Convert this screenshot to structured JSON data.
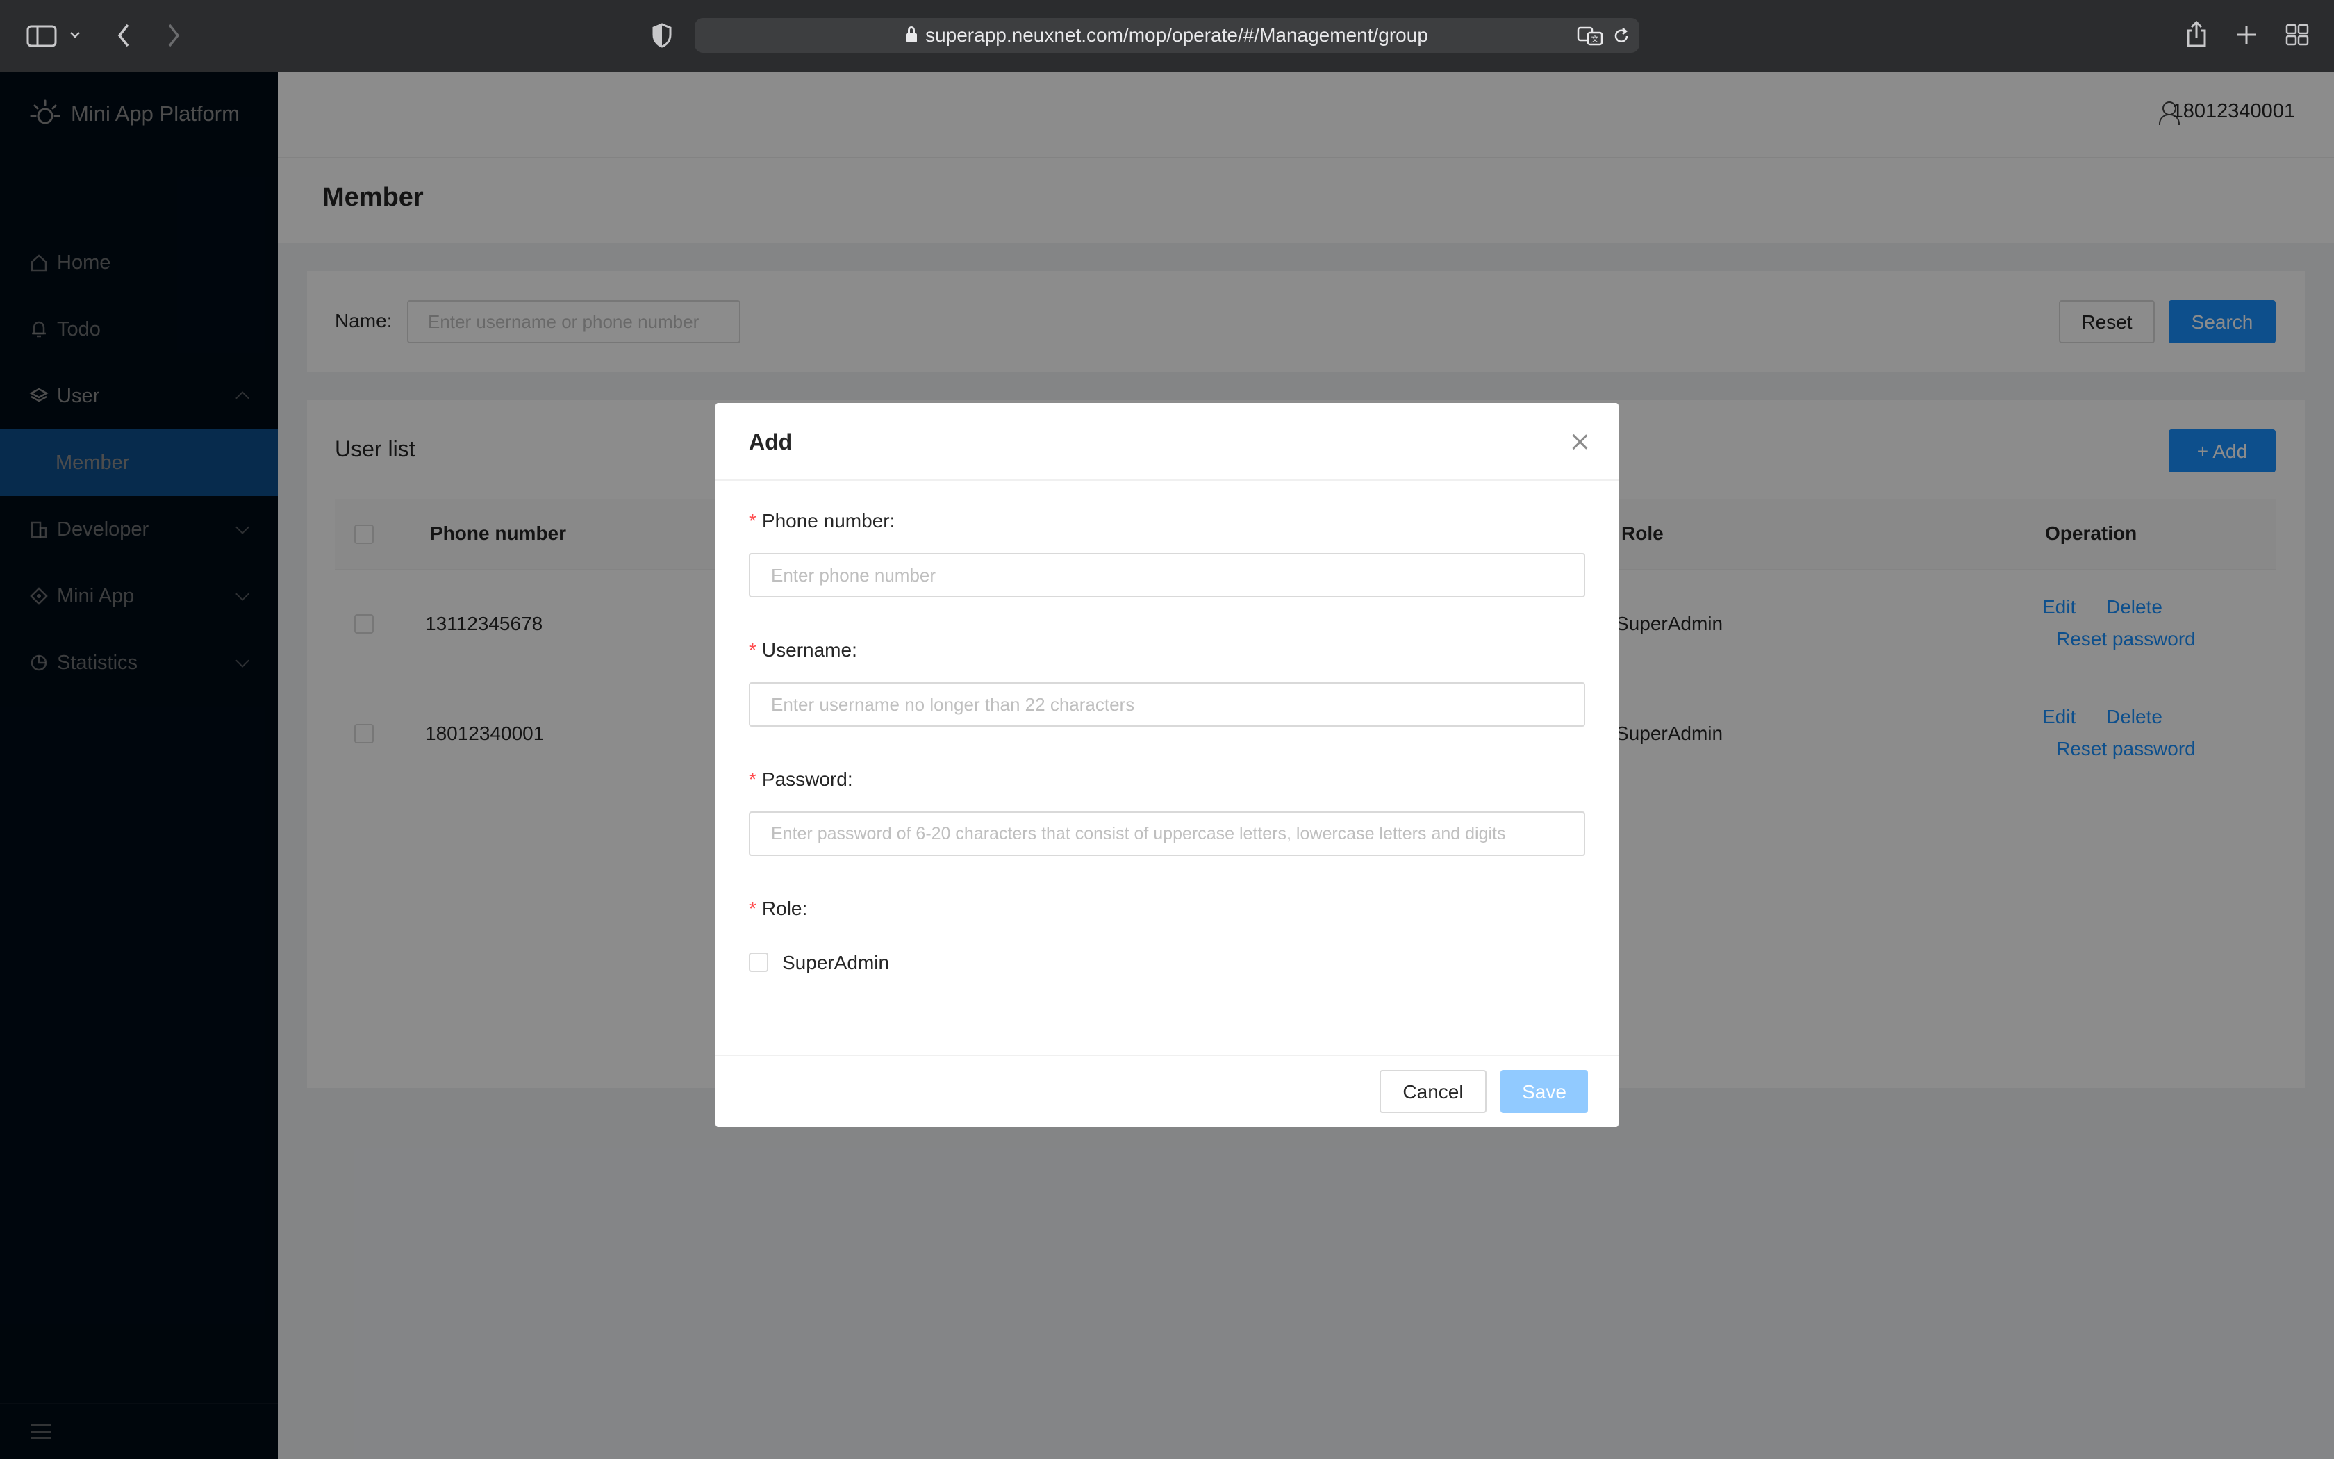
{
  "browser": {
    "url": "superapp.neuxnet.com/mop/operate/#/Management/group"
  },
  "sidebar": {
    "app_name": "Mini App Platform",
    "items": [
      {
        "label": "Home"
      },
      {
        "label": "Todo"
      },
      {
        "label": "User"
      },
      {
        "label": "Member"
      },
      {
        "label": "Developer"
      },
      {
        "label": "Mini App"
      },
      {
        "label": "Statistics"
      }
    ]
  },
  "header": {
    "username": "18012340001"
  },
  "page": {
    "title": "Member"
  },
  "search": {
    "label": "Name:",
    "placeholder": "Enter username or phone number",
    "reset_label": "Reset",
    "search_label": "Search"
  },
  "table": {
    "title": "User list",
    "add_label": "+ Add",
    "columns": {
      "phone": "Phone number",
      "role": "Role",
      "operation": "Operation"
    },
    "rows": [
      {
        "phone": "13112345678",
        "role": "SuperAdmin",
        "edit": "Edit",
        "delete": "Delete",
        "reset": "Reset password"
      },
      {
        "phone": "18012340001",
        "role": "SuperAdmin",
        "edit": "Edit",
        "delete": "Delete",
        "reset": "Reset password"
      }
    ]
  },
  "modal": {
    "title": "Add",
    "required_mark": "*",
    "fields": {
      "phone": {
        "label": "Phone number:",
        "placeholder": "Enter phone number"
      },
      "username": {
        "label": "Username:",
        "placeholder": "Enter username no longer than 22 characters"
      },
      "password": {
        "label": "Password:",
        "placeholder": "Enter password of 6-20 characters that consist of uppercase letters, lowercase letters and digits"
      },
      "role": {
        "label": "Role:",
        "option": "SuperAdmin"
      }
    },
    "cancel_label": "Cancel",
    "save_label": "Save"
  }
}
